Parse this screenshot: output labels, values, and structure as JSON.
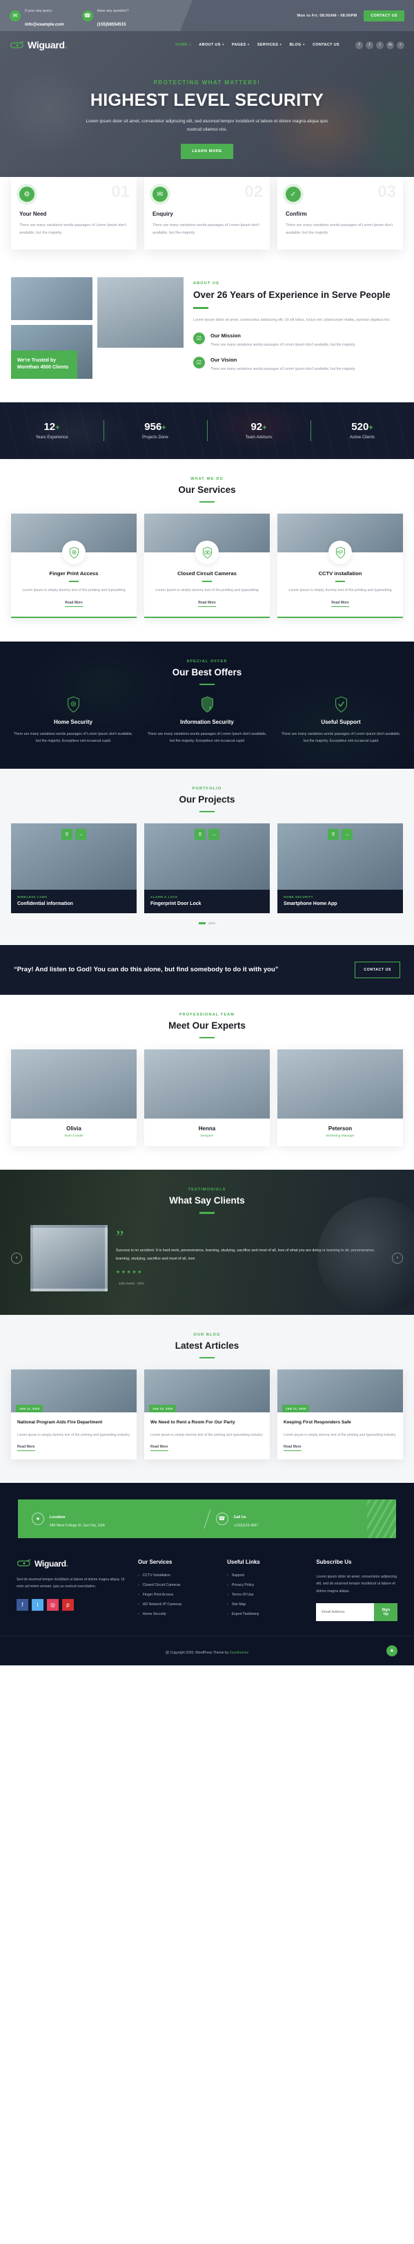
{
  "topbar": {
    "query_label": "If your any query:",
    "query_value": "info@example.com",
    "question_label": "Have any question?",
    "question_value": "(155)56554515",
    "hours": "Mon to Fri: 08:00AM - 08:00PM",
    "cta": "CONTACT US",
    "mail_icon": "mail-icon",
    "phone_icon": "phone-icon"
  },
  "nav": {
    "brand": "Wiguard",
    "brand_dot": ".",
    "items": [
      {
        "label": "HOME",
        "caret": "+"
      },
      {
        "label": "ABOUT US",
        "caret": "+"
      },
      {
        "label": "PAGES",
        "caret": "+"
      },
      {
        "label": "SERVICES",
        "caret": "+"
      },
      {
        "label": "BLOG",
        "caret": "+"
      },
      {
        "label": "CONTACT US",
        "caret": ""
      }
    ],
    "social": [
      {
        "name": "facebook-icon",
        "glyph": "f"
      },
      {
        "name": "twitter-icon",
        "glyph": "t"
      },
      {
        "name": "instagram-icon",
        "glyph": "i"
      },
      {
        "name": "linkedin-icon",
        "glyph": "in"
      },
      {
        "name": "search-icon",
        "glyph": "⌕"
      }
    ]
  },
  "hero": {
    "kicker": "PROTECTING WHAT MATTERS!",
    "title": "HIGHEST LEVEL SECURITY",
    "subtitle": "Lorem ipsum dolor sit amet, consectetur adipiscing elit, sed eiusmod tempor incididunt ut labore et dolore magna aliqua quis nostrud ullamco nisi.",
    "button": "LEARN MORE"
  },
  "process_cards": [
    {
      "number": "01",
      "title": "Your Need",
      "text": "There are many variations words passages of Lorem Ipsum don't available, but the majority.",
      "icon": "gear-icon"
    },
    {
      "number": "02",
      "title": "Enquiry",
      "text": "There are many variations words passages of Lorem Ipsum don't available, but the majority.",
      "icon": "envelope-icon"
    },
    {
      "number": "03",
      "title": "Confirm",
      "text": "There are many variations words passages of Lorem Ipsum don't available, but the majority.",
      "icon": "check-shield-icon"
    }
  ],
  "about": {
    "kicker": "ABOUT US",
    "title": "Over 26 Years of Experience in Serve People",
    "paragraph": "Lorem ipsum dolor sit amet, consectetur adipiscing elit. Ut elit tellus, luctus nec ullamcorper mattis, pulvinar dapibus leo.",
    "badge": "We're Trusted by Morethan 4500 Clients",
    "features": [
      {
        "title": "Our Mission",
        "text": "There are many variations words passages of Lorem Ipsum don't available, but the majority.",
        "icon": "check-square-icon"
      },
      {
        "title": "Our Vision",
        "text": "There are many variations words passages of Lorem Ipsum don't available, but the majority.",
        "icon": "check-square-icon"
      }
    ]
  },
  "stats": [
    {
      "number": "12",
      "plus": "+",
      "label": "Years Experience"
    },
    {
      "number": "956",
      "plus": "+",
      "label": "Projects Done"
    },
    {
      "number": "92",
      "plus": "+",
      "label": "Team Advisors"
    },
    {
      "number": "520",
      "plus": "+",
      "label": "Active Clients"
    }
  ],
  "services": {
    "kicker": "WHAT WE DO",
    "title": "Our Services",
    "items": [
      {
        "title": "Finger Print Access",
        "text": "Lorem Ipsum is simply dummy text of the printing and typesetting",
        "read_more": "Read More",
        "icon": "fingerprint-shield-icon"
      },
      {
        "title": "Closed Circuit Cameras",
        "text": "Lorem Ipsum is simply dummy text of the printing and typesetting",
        "read_more": "Read More",
        "icon": "camera-shield-icon"
      },
      {
        "title": "CCTV installation",
        "text": "Lorem Ipsum is simply dummy text of the printing and typesetting",
        "read_more": "Read More",
        "icon": "cctv-shield-icon"
      }
    ]
  },
  "offers": {
    "kicker": "SPECIAL OFFER",
    "title": "Our Best Offers",
    "items": [
      {
        "title": "Home Security",
        "text": "There are many variations words passages of Lorem Ipsum don't available, but the majority. Exceptteur sint occaecat cupid",
        "icon": "gear-shield-icon"
      },
      {
        "title": "Information Security",
        "text": "There are many variations words passages of Lorem Ipsum don't available, but the majority. Exceptteur sint occaecat cupid",
        "icon": "data-shield-icon"
      },
      {
        "title": "Useful Support",
        "text": "There are many variations words passages of Lorem Ipsum don't available, but the majority. Exceptteur sint occaecat cupid",
        "icon": "check-shield-icon"
      }
    ]
  },
  "projects": {
    "kicker": "PORTFOLIO",
    "title": "Our Projects",
    "items": [
      {
        "category": "WIRELESS CAMS",
        "title": "Confidential information",
        "zoom_icon": "zoom-icon",
        "link_icon": "arrow-right-icon"
      },
      {
        "category": "ALARM & LOCK",
        "title": "Fingerprint Door Lock",
        "zoom_icon": "zoom-icon",
        "link_icon": "arrow-right-icon"
      },
      {
        "category": "HOME SECURITY",
        "title": "Smartphone Home App",
        "zoom_icon": "zoom-icon",
        "link_icon": "arrow-right-icon"
      }
    ]
  },
  "cta": {
    "quote": "“Pray! And listen to God! You can do this alone, but find somebody to do it with you”",
    "button": "CONTACT US"
  },
  "team": {
    "kicker": "PROFESSIONAL TEAM",
    "title": "Meet Our Experts",
    "members": [
      {
        "name": "Olivia",
        "role": "Team Leader"
      },
      {
        "name": "Henna",
        "role": "Designer"
      },
      {
        "name": "Peterson",
        "role": "Marketing Manager"
      }
    ]
  },
  "testimonial": {
    "kicker": "TESTIMONIALS",
    "title": "What Say Clients",
    "quote_mark": "”",
    "text": "Success is no accident. It is hard work, perseverance, learning, studying, sacrifice and most of all, love of what you are doing or learning to do. perseverance, learning, studying, sacrifice and most of all, love",
    "stars": "★★★★★",
    "name": "John David",
    "role": "CEO",
    "prev_icon": "chevron-left-icon",
    "next_icon": "chevron-right-icon"
  },
  "blog": {
    "kicker": "OUR BLOG",
    "title": "Latest Articles",
    "posts": [
      {
        "date": "JAN 12, 2020",
        "title": "National Program Aids Fire Department",
        "text": "Lorem ipsum is simply dummy text of the printing and typesetting industry.",
        "read_more": "Read More"
      },
      {
        "date": "JAN 12, 2020",
        "title": "We Need to Rent a Room For Our Party",
        "text": "Lorem ipsum is simply dummy text of the printing and typesetting industry.",
        "read_more": "Read More"
      },
      {
        "date": "JAN 12, 2020",
        "title": "Keeping First Responders Safe",
        "text": "Lorem ipsum is simply dummy text of the printing and typesetting industry.",
        "read_more": "Read More"
      }
    ]
  },
  "contact_strip": {
    "location_label": "Location",
    "location_value": "684 West College St. Sun City, USA",
    "location_icon": "map-pin-icon",
    "call_label": "Call Us",
    "call_value": "+(315)123-4567",
    "call_icon": "headset-icon"
  },
  "footer": {
    "brand": "Wiguard",
    "brand_dot": ".",
    "about": "Sed do eiusmod tempor incididunt ut labore et dolore magna aliqua. Ut enim ad minim veniam, quis us nostrud exercitation.",
    "social": [
      {
        "name": "facebook-icon",
        "glyph": "f",
        "color": "#3b5998"
      },
      {
        "name": "twitter-icon",
        "glyph": "t",
        "color": "#55acee"
      },
      {
        "name": "instagram-icon",
        "glyph": "◎",
        "color": "#e4405f"
      },
      {
        "name": "pinterest-icon",
        "glyph": "p",
        "color": "#d32d2f"
      }
    ],
    "services_heading": "Our Services",
    "services": [
      "CCTV Installation",
      "Closed Circuit Cameras",
      "Finger Print Access",
      "HD Network IP Cameras",
      "Home Security"
    ],
    "links_heading": "Useful Links",
    "links": [
      "Support",
      "Privacy Policy",
      "Terms Of Use",
      "Site Map",
      "Expert Testimony"
    ],
    "subscribe_heading": "Subscribe Us",
    "subscribe_text": "Lorem ipsum dolor sit amet, consectetur adipiscing elit, sed do eiusmod tempor incididunt ut labore et dolore magna aliqua.",
    "email_placeholder": "Email Address",
    "signup_label": "Sign Up",
    "copyright": "@ Copyright 2020. WordPress Theme by ",
    "copyright_link": "Zozothemes",
    "to_top_icon": "chevron-up-icon"
  },
  "colors": {
    "accent": "#4cb050",
    "dark": "#0d1426",
    "navy": "#141b2e"
  }
}
